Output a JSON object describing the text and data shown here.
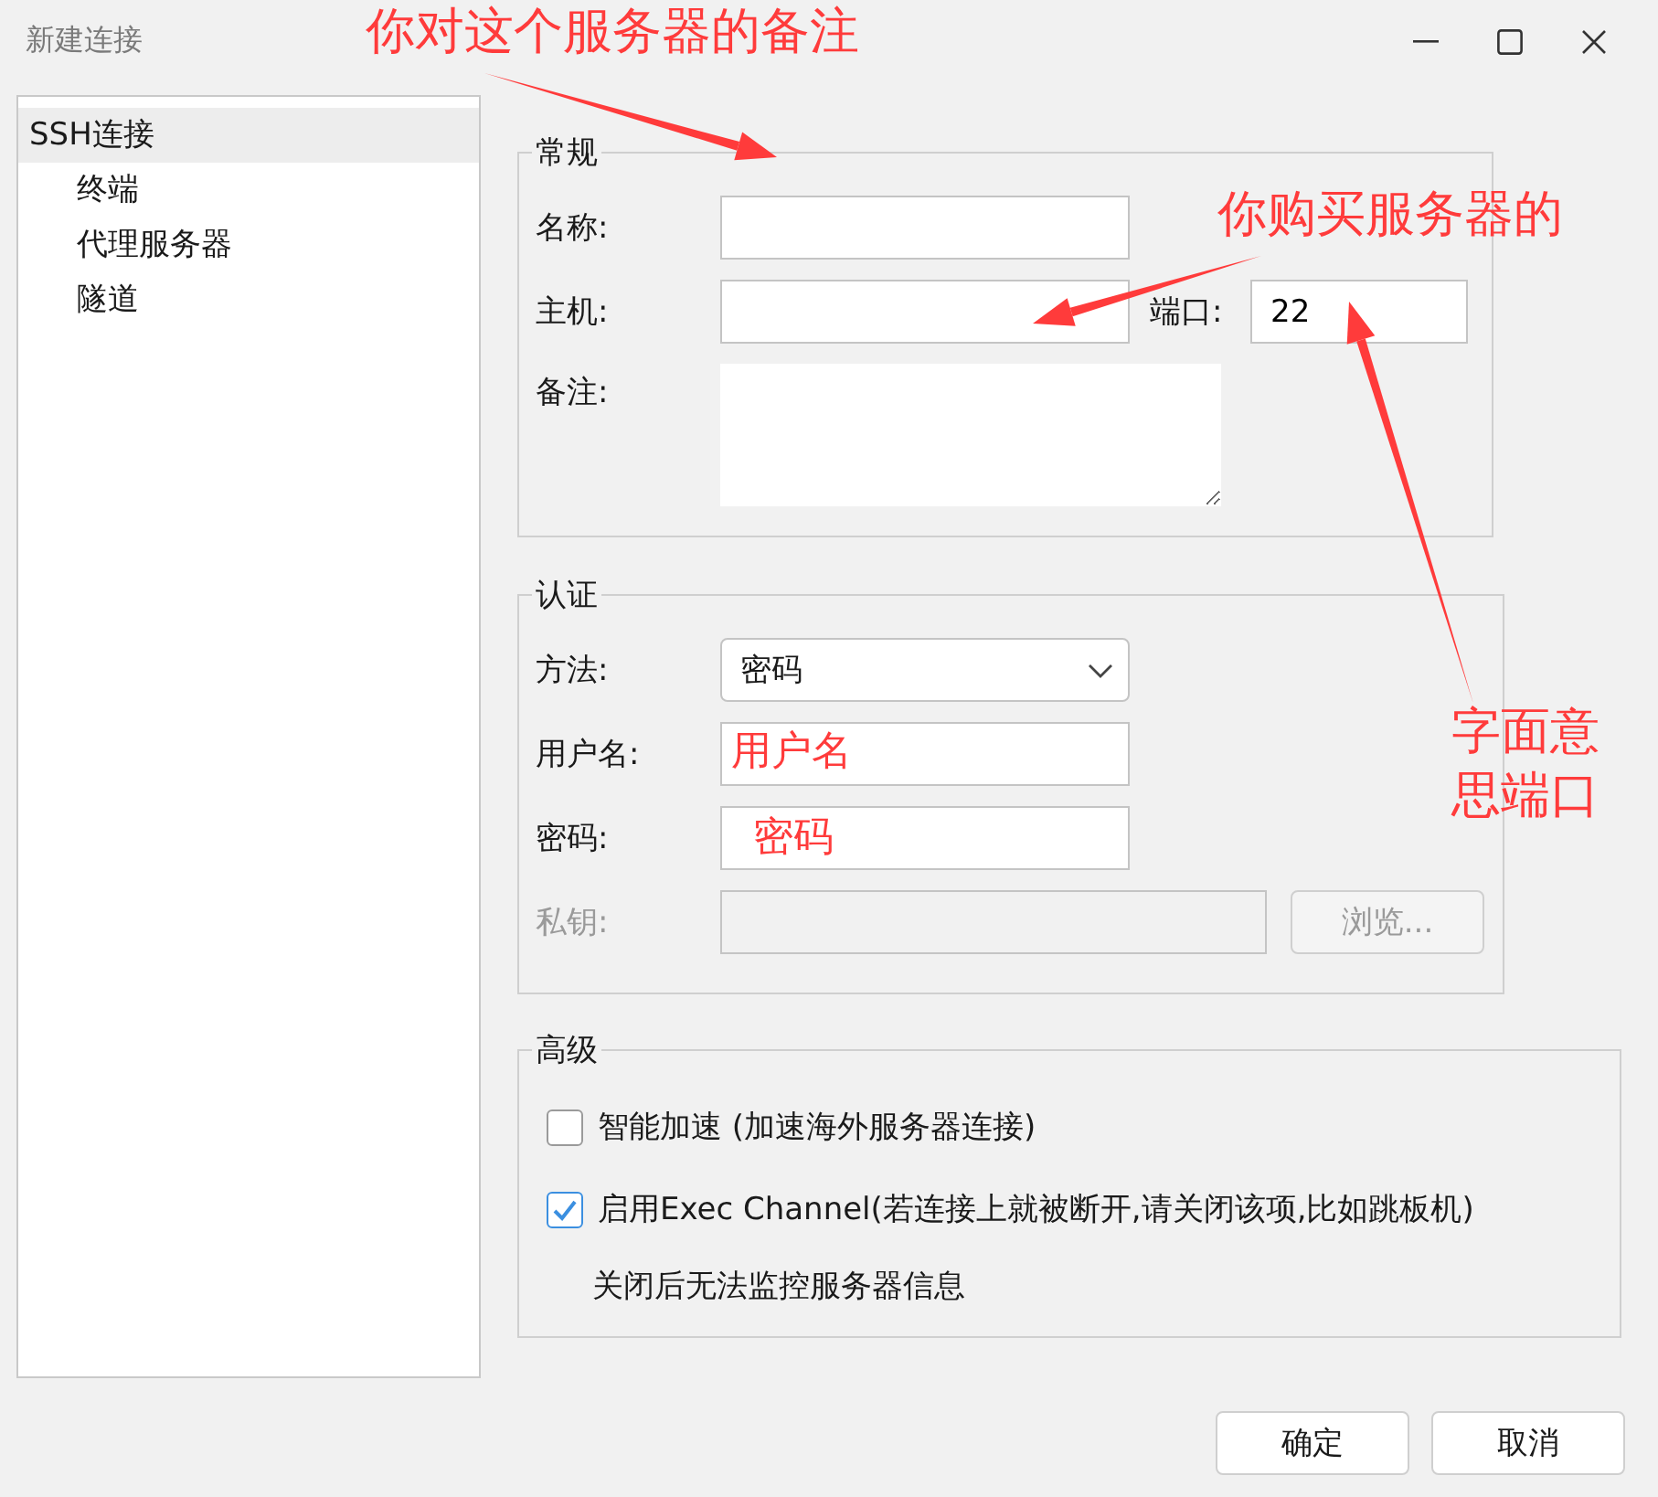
{
  "window": {
    "title": "新建连接"
  },
  "tree": [
    {
      "label": "SSH连接",
      "selected": true,
      "children": [
        {
          "label": "终端",
          "selected": false
        },
        {
          "label": "代理服务器",
          "selected": false
        },
        {
          "label": "隧道",
          "selected": false
        }
      ]
    }
  ],
  "general": {
    "title": "常规",
    "name_label": "名称:",
    "host_label": "主机:",
    "port_label": "端口:",
    "port_value": "22",
    "note_label": "备注:"
  },
  "auth": {
    "title": "认证",
    "method_label": "方法:",
    "method_value": "密码",
    "user_label": "用户名:",
    "password_label": "密码:",
    "key_label": "私钥:",
    "key_disabled": true,
    "browse_label": "浏览...",
    "browse_disabled": true
  },
  "advanced": {
    "title": "高级",
    "options": [
      {
        "label": "智能加速 (加速海外服务器连接)",
        "checked": false
      },
      {
        "label": "启用Exec Channel(若连接上就被断开,请关闭该项,比如跳板机)",
        "checked": true
      }
    ],
    "note": "关闭后无法监控服务器信息"
  },
  "buttons": [
    "确定",
    "取消"
  ],
  "annotations": [
    {
      "text": "你对这个服务器的备注",
      "kind": "callout"
    },
    {
      "text": "你购买服务器的",
      "kind": "callout"
    },
    {
      "text": "用户名",
      "kind": "inline"
    },
    {
      "text": "密码",
      "kind": "inline"
    },
    {
      "text": "字面意思端口",
      "kind": "callout"
    }
  ]
}
